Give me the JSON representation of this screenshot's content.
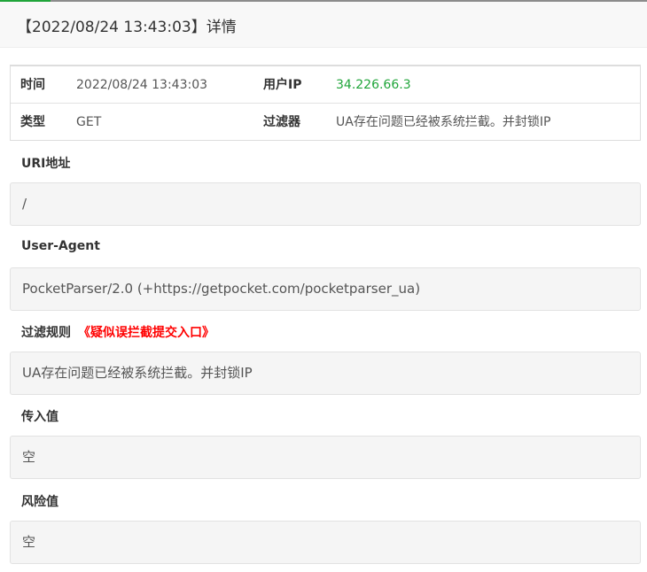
{
  "dialog": {
    "title": "【2022/08/24 13:43:03】详情"
  },
  "info": {
    "time_label": "时间",
    "time_value": "2022/08/24 13:43:03",
    "ip_label": "用户IP",
    "ip_value": "34.226.66.3",
    "type_label": "类型",
    "type_value": "GET",
    "filter_label": "过滤器",
    "filter_value": "UA存在问题已经被系统拦截。并封锁IP"
  },
  "sections": {
    "uri": {
      "label": "URI地址",
      "value": "/"
    },
    "user_agent": {
      "label": "User-Agent",
      "value": "PocketParser/2.0 (+https://getpocket.com/pocketparser_ua)"
    },
    "rule": {
      "label": "过滤规则",
      "link": "《疑似误拦截提交入口》",
      "value": "UA存在问题已经被系统拦截。并封锁IP"
    },
    "incoming": {
      "label": "传入值",
      "value": "空"
    },
    "risk": {
      "label": "风险值",
      "value": "空"
    }
  },
  "colors": {
    "accent_green": "#20a53a",
    "link_red": "#ff0000"
  }
}
